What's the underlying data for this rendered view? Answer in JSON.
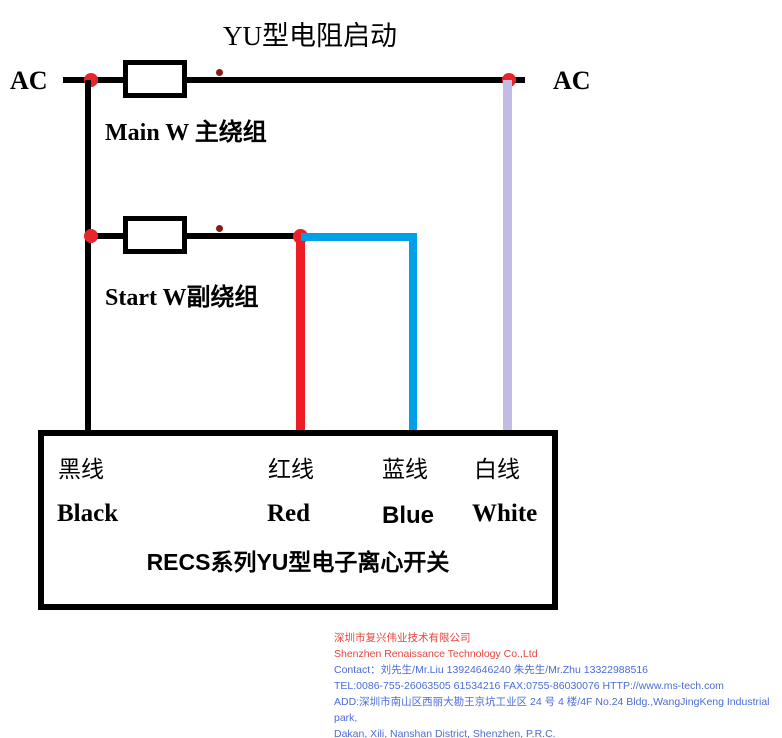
{
  "title": "YU型电阻启动",
  "terminals": {
    "left_ac": "AC",
    "right_ac": "AC"
  },
  "windings": [
    {
      "id": "main",
      "label": "Main W  主绕组"
    },
    {
      "id": "start",
      "label": "Start W副绕组"
    }
  ],
  "leads": [
    {
      "name": "black",
      "color": "#000000",
      "label_cn": "黑线",
      "label_en": "Black"
    },
    {
      "name": "red",
      "color": "#ee1c25",
      "label_cn": "红线",
      "label_en": "Red"
    },
    {
      "name": "blue",
      "color": "#00a0e9",
      "label_cn": "蓝线",
      "label_en": "Blue"
    },
    {
      "name": "white",
      "color": "#c0bce4",
      "label_cn": "白线",
      "label_en": "White"
    }
  ],
  "device": {
    "title": "RECS系列YU型电子离心开关"
  },
  "footer": {
    "company_cn": "深圳市复兴伟业技术有限公司",
    "company_en": "Shenzhen Renaissance Technology Co.,Ltd",
    "contact": "Contact：刘先生/Mr.Liu    13924646240      朱先生/Mr.Zhu    13322988516",
    "tel": "TEL:0086-755-26063505 61534216      FAX:0755-86030076    HTTP://www.ms-tech.com",
    "address_line1": "ADD:深圳市南山区西丽大勘王京坑工业区 24 号 4 楼/4F No.24 Bldg.,WangJingKeng Industrial park,",
    "address_line2": "Dakan, Xili, Nanshan District, Shenzhen, P.R.C."
  },
  "colors": {
    "wire_black": "#000000",
    "wire_red": "#ee1c25",
    "wire_blue": "#00a0e9",
    "wire_white": "#c0bce4",
    "node_red": "#e8252b",
    "footer_red": "#e8453c",
    "footer_blue": "#4b6cd6"
  }
}
